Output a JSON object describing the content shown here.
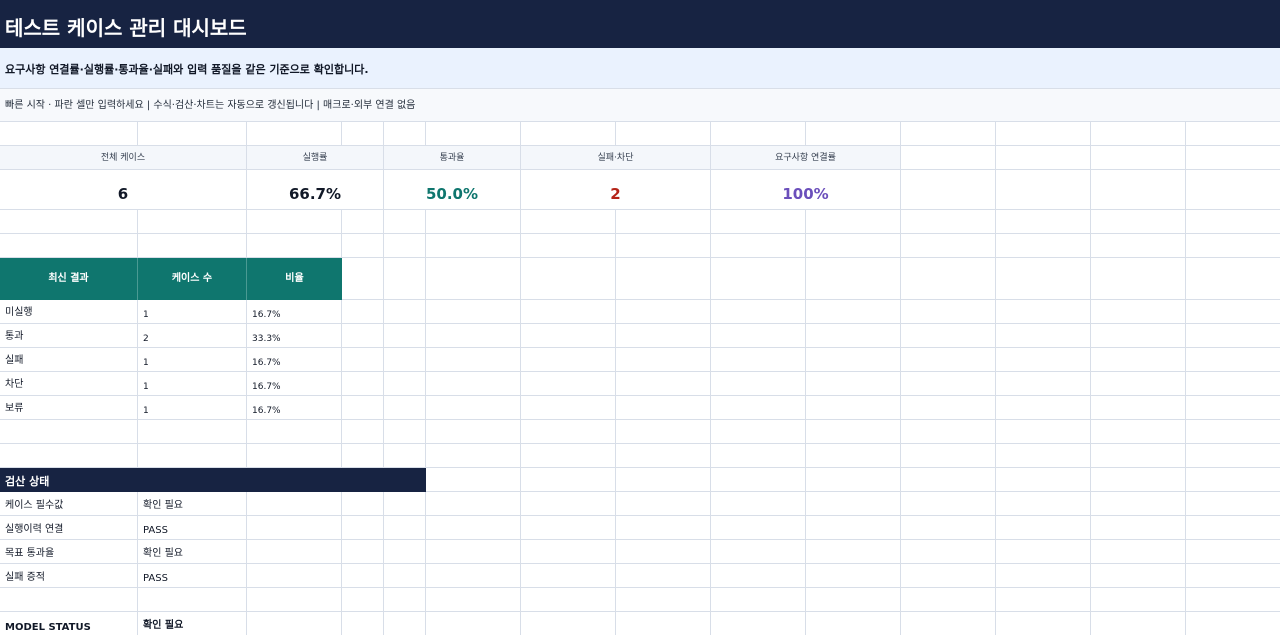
{
  "header": {
    "title": "테스트 케이스 관리 대시보드",
    "subtitle": "요구사항 연결률·실행률·통과율·실패와 입력 품질을 같은 기준으로 확인합니다.",
    "help": "빠른 시작 · 파란 셀만 입력하세요  |  수식·검산·차트는 자동으로 갱신됩니다  |  매크로·외부 연결 없음"
  },
  "kpis": [
    {
      "label": "전체 케이스",
      "value": "6",
      "color": "#111827"
    },
    {
      "label": "실행률",
      "value": "66.7%",
      "color": "#111827"
    },
    {
      "label": "통과율",
      "value": "50.0%",
      "color": "#0f766e"
    },
    {
      "label": "실패·차단",
      "value": "2",
      "color": "#b42318"
    },
    {
      "label": "요구사항 연결률",
      "value": "100%",
      "color": "#6b4fbb"
    }
  ],
  "results_table": {
    "headers": [
      "최신 결과",
      "케이스 수",
      "비율"
    ],
    "rows": [
      {
        "result": "미실행",
        "count": "1",
        "ratio": "16.7%"
      },
      {
        "result": "통과",
        "count": "2",
        "ratio": "33.3%"
      },
      {
        "result": "실패",
        "count": "1",
        "ratio": "16.7%"
      },
      {
        "result": "차단",
        "count": "1",
        "ratio": "16.7%"
      },
      {
        "result": "보류",
        "count": "1",
        "ratio": "16.7%"
      }
    ]
  },
  "checks": {
    "title": "검산 상태",
    "rows": [
      {
        "label": "케이스 필수값",
        "status": "확인 필요"
      },
      {
        "label": "실행이력 연결",
        "status": "PASS"
      },
      {
        "label": "목표 통과율",
        "status": "확인 필요"
      },
      {
        "label": "실패 증적",
        "status": "PASS"
      }
    ],
    "model_status_label": "MODEL STATUS",
    "model_status_value": "확인 필요"
  },
  "colors": {
    "title_bg": "#172342",
    "subtitle_bg": "#eaf2fe",
    "table_header_bg": "#0f766e",
    "gridline": "#d8dee8"
  }
}
